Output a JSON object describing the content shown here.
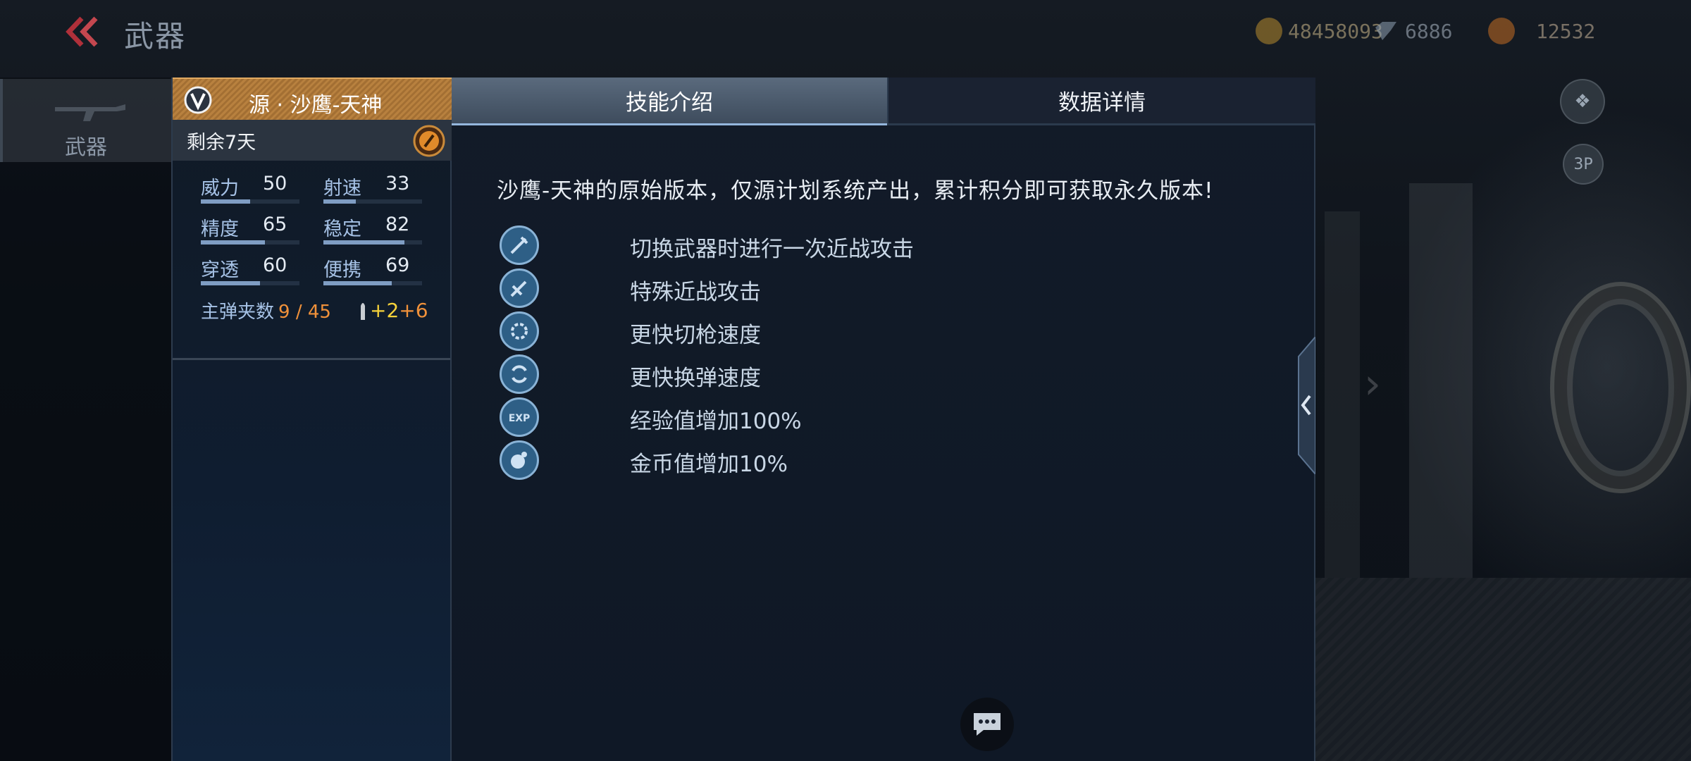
{
  "header": {
    "title": "武器",
    "currencies": [
      {
        "name": "credit",
        "value": "48458093",
        "color": "#d8b04a",
        "icon": "coin-icon"
      },
      {
        "name": "diamond",
        "value": "6886",
        "color": "#9fb3c8",
        "icon": "diamond-icon"
      },
      {
        "name": "gold",
        "value": "12532",
        "color": "#e28a2e",
        "icon": "gold-icon"
      }
    ]
  },
  "nav": {
    "weapon_label": "武器"
  },
  "right_buttons": {
    "view_3p": "3P"
  },
  "weapon": {
    "name": "源 · 沙鹰-天神",
    "remaining": "剩余7天",
    "stats": [
      {
        "label": "威力",
        "value": "50",
        "level": 0.5
      },
      {
        "label": "射速",
        "value": "33",
        "level": 0.33
      },
      {
        "label": "精度",
        "value": "65",
        "level": 0.65
      },
      {
        "label": "稳定",
        "value": "82",
        "level": 0.82
      },
      {
        "label": "穿透",
        "value": "60",
        "level": 0.6
      },
      {
        "label": "便携",
        "value": "69",
        "level": 0.69
      }
    ],
    "magazine_label": "主弹夹数",
    "magazine_value": "9 / 45",
    "bonus_a": "+2",
    "bonus_b": "+6"
  },
  "tabs": {
    "skill": "技能介绍",
    "data": "数据详情"
  },
  "content": {
    "description": "沙鹰-天神的原始版本，仅源计划系统产出，累计积分即可获取永久版本!",
    "skills": [
      {
        "text": "切换武器时进行一次近战攻击",
        "icon": "switch-melee-icon"
      },
      {
        "text": "特殊近战攻击",
        "icon": "special-melee-icon"
      },
      {
        "text": "更快切枪速度",
        "icon": "fast-switch-icon"
      },
      {
        "text": "更快换弹速度",
        "icon": "fast-reload-icon"
      },
      {
        "text": "经验值增加100%",
        "icon": "exp-icon"
      },
      {
        "text": "金币值增加10%",
        "icon": "gold-coin-icon"
      }
    ]
  },
  "colors": {
    "accent": "#b8813f",
    "ammo": "#f0913a",
    "bonus": "#f6d23a",
    "tab_active": "#95b7dd"
  }
}
